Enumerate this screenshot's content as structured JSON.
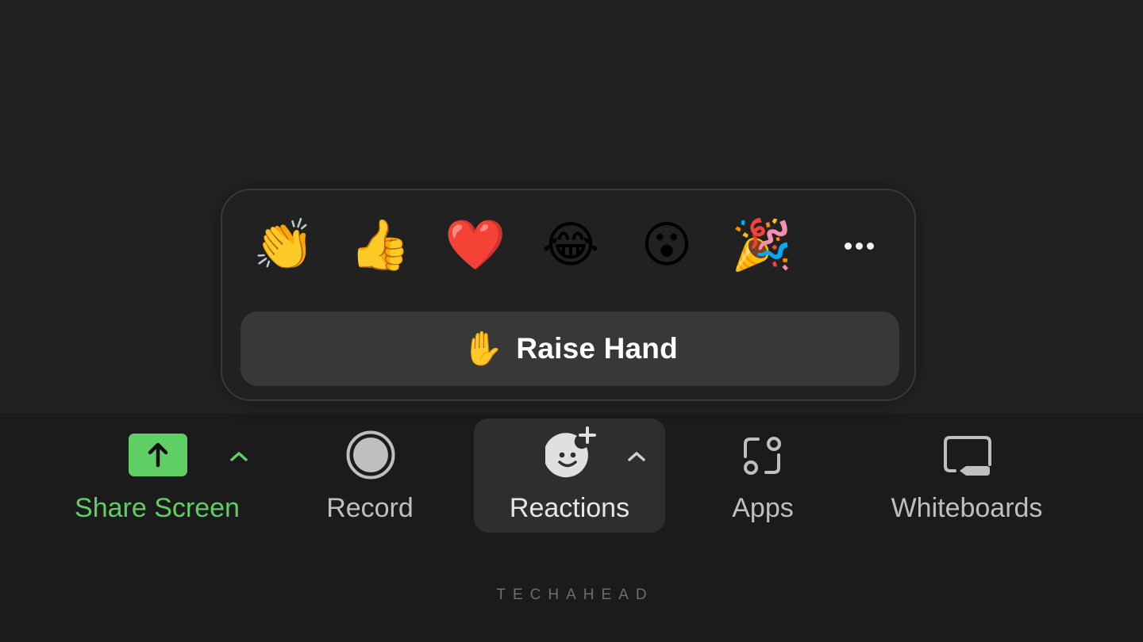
{
  "reactions_popup": {
    "emojis": [
      {
        "name": "clapping-hands",
        "glyph": "👏"
      },
      {
        "name": "thumbs-up",
        "glyph": "👍"
      },
      {
        "name": "red-heart",
        "glyph": "❤️"
      },
      {
        "name": "tears-of-joy",
        "glyph": "😂"
      },
      {
        "name": "open-mouth",
        "glyph": "😮"
      },
      {
        "name": "party-popper",
        "glyph": "🎉"
      }
    ],
    "more_icon": "more-horizontal-icon",
    "raise_hand": {
      "glyph": "✋",
      "label": "Raise Hand"
    }
  },
  "toolbar": {
    "items": [
      {
        "id": "share-screen",
        "label": "Share Screen",
        "icon": "share-screen-icon",
        "has_caret": true,
        "color": "#5fcf65"
      },
      {
        "id": "record",
        "label": "Record",
        "icon": "record-icon",
        "has_caret": false
      },
      {
        "id": "reactions",
        "label": "Reactions",
        "icon": "reactions-icon",
        "has_caret": true,
        "active": true
      },
      {
        "id": "apps",
        "label": "Apps",
        "icon": "apps-icon",
        "has_caret": false
      },
      {
        "id": "whiteboards",
        "label": "Whiteboards",
        "icon": "whiteboards-icon",
        "has_caret": false
      }
    ]
  },
  "colors": {
    "accent_green": "#5fcf65",
    "icon_gray": "#bfbfbf",
    "background": "#222222",
    "toolbar_bg": "#1b1b1b"
  },
  "watermark": "TECHAHEAD"
}
